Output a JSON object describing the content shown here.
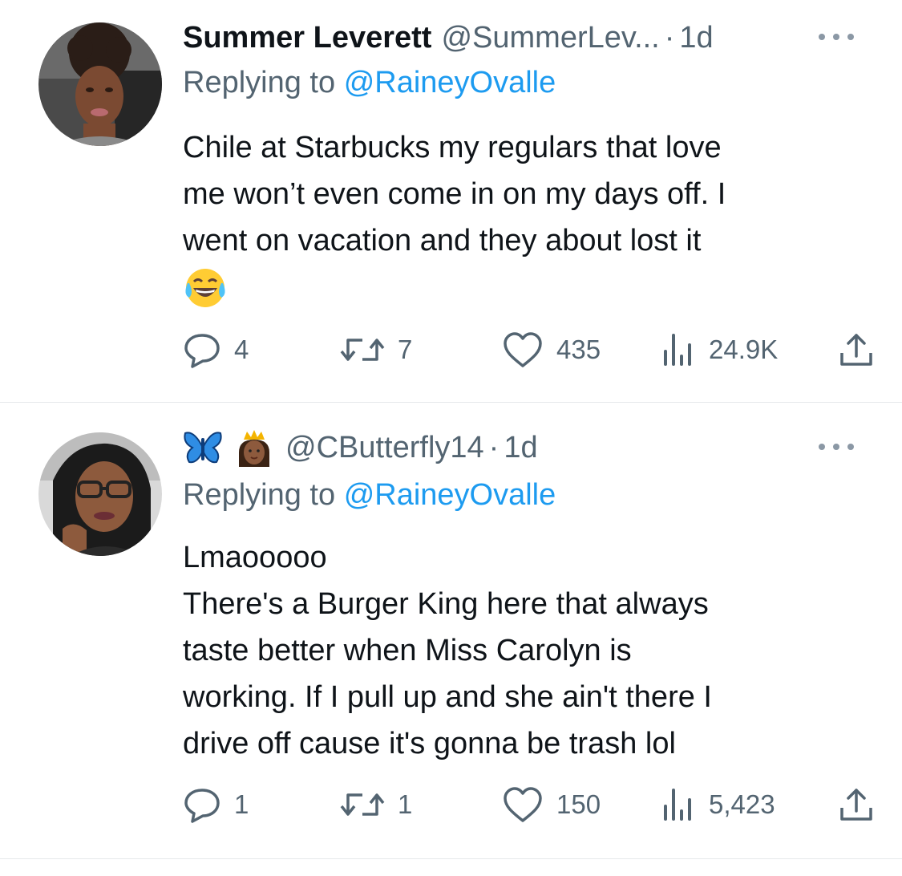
{
  "tweets": [
    {
      "display_name": "Summer Leverett",
      "handle": "@SummerLev...",
      "separator": "·",
      "time": "1d",
      "replying_prefix": "Replying to",
      "replying_handle": "@RaineyOvalle",
      "body_lines": [
        "Chile at Starbucks my regulars that love",
        "me won’t even come in on my days off. I",
        "went on vacation and they about lost it"
      ],
      "trailing_emoji": "face-with-tears-of-joy-emoji",
      "stats": {
        "replies": "4",
        "retweets": "7",
        "likes": "435",
        "views": "24.9K"
      }
    },
    {
      "name_emojis": [
        "blue-butterfly-emoji",
        "princess-emoji"
      ],
      "handle": "@CButterfly14",
      "separator": "·",
      "time": "1d",
      "replying_prefix": "Replying to",
      "replying_handle": "@RaineyOvalle",
      "body_lines": [
        "Lmaooooo",
        "There's a Burger King here that always",
        "taste better when Miss Carolyn is",
        "working.  If I pull up and she ain't there I",
        "drive off cause it's gonna be trash lol"
      ],
      "stats": {
        "replies": "1",
        "retweets": "1",
        "likes": "150",
        "views": "5,423"
      }
    }
  ],
  "icons": {
    "reply": "reply-bubble-icon",
    "retweet": "retweet-icon",
    "like": "heart-icon",
    "views": "views-bar-chart-icon",
    "share": "share-upload-icon",
    "more": "more-dots-icon"
  },
  "colors": {
    "text_primary": "#0f1419",
    "text_secondary": "#536471",
    "link_blue": "#1d9bf0",
    "divider": "#e6e9eb"
  }
}
